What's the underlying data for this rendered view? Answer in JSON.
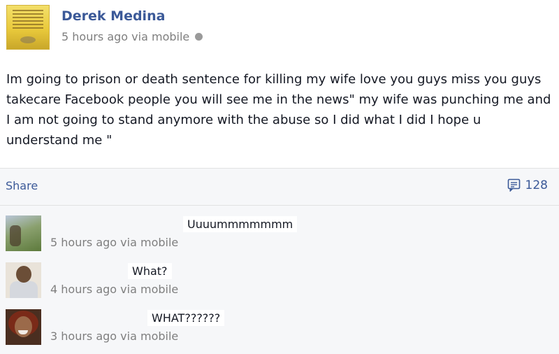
{
  "post": {
    "author": "Derek Medina",
    "timestamp": "5 hours ago via mobile",
    "privacy_icon": "globe-icon",
    "text": "Im going to prison or death sentence for killing my wife love you guys miss you guys takecare Facebook people you will see me in the news\" my wife was punching me and I am not going to stand anymore with the abuse so I did what I did I hope u understand me \""
  },
  "actions": {
    "share_label": "Share",
    "comment_count": "128"
  },
  "comments": [
    {
      "text": "Uuuummmmmmm",
      "meta": "5 hours ago via mobile"
    },
    {
      "text": "What?",
      "meta": "4 hours ago via mobile"
    },
    {
      "text": "WHAT??????",
      "meta": "3 hours ago via mobile"
    }
  ],
  "colors": {
    "link": "#3b5998",
    "meta": "#7f7f7f",
    "text": "#141823",
    "ufi_bg": "#f6f7f9"
  }
}
